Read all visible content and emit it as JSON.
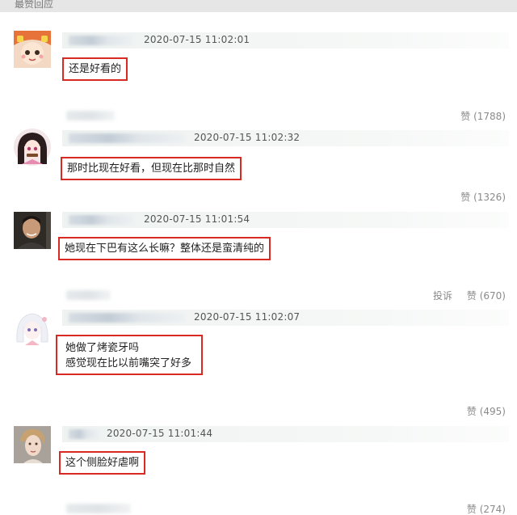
{
  "section_title": "最赞回应",
  "comments": [
    {
      "avatar": "anime-girl-avatar",
      "timestamp": "2020-07-15 11:02:01",
      "lines": [
        "还是好看的"
      ],
      "like_label": "赞 (1788)",
      "report_label": ""
    },
    {
      "avatar": "anime-girl-dark-hair-avatar",
      "timestamp": "2020-07-15 11:02:32",
      "lines": [
        "那时比现在好看，但现在比那时自然"
      ],
      "like_label": "赞 (1326)",
      "report_label": ""
    },
    {
      "avatar": "man-photo-avatar",
      "timestamp": "2020-07-15 11:01:54",
      "lines": [
        "她现在下巴有这么长嘛？整体还是蛮清纯的"
      ],
      "like_label": "赞 (670)",
      "report_label": "投诉"
    },
    {
      "avatar": "white-hair-anime-avatar",
      "timestamp": "2020-07-15 11:02:07",
      "lines": [
        "她做了烤瓷牙吗",
        "感觉现在比以前嘴突了好多"
      ],
      "like_label": "赞 (495)",
      "report_label": ""
    },
    {
      "avatar": "woman-photo-avatar",
      "timestamp": "2020-07-15 11:01:44",
      "lines": [
        "这个侧脸好虐啊"
      ],
      "like_label": "赞 (274)",
      "report_label": ""
    }
  ],
  "colors": {
    "highlight_border": "#d82a22",
    "meta_bar": "#eef2f0",
    "like_text": "#8a8a8a"
  }
}
